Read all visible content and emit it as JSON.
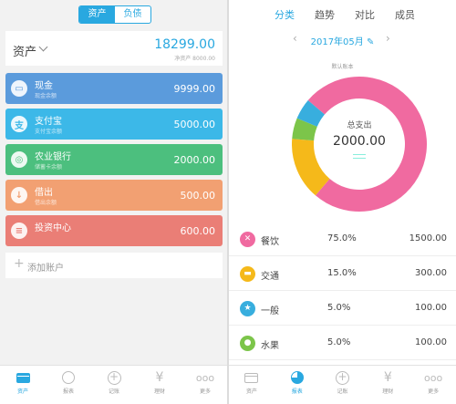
{
  "left": {
    "segment": [
      "资产",
      "负债"
    ],
    "summary_title": "资产",
    "summary_amount": "18299.00",
    "summary_sub": "净资产 8000.00",
    "accounts": [
      {
        "icon": "cash-icon",
        "glyph": "▭",
        "name": "现金",
        "desc": "现金余额",
        "value": "9999.00",
        "color": "#5b9bdc"
      },
      {
        "icon": "alipay-icon",
        "glyph": "支",
        "name": "支付宝",
        "desc": "支付宝余额",
        "value": "5000.00",
        "color": "#3cb8e8"
      },
      {
        "icon": "bank-icon",
        "glyph": "◎",
        "name": "农业银行",
        "desc": "储蓄卡余额",
        "value": "2000.00",
        "color": "#4cbf7e"
      },
      {
        "icon": "loan-icon",
        "glyph": "↓",
        "name": "借出",
        "desc": "借出余额",
        "value": "500.00",
        "color": "#f2a072"
      },
      {
        "icon": "invest-icon",
        "glyph": "≡",
        "name": "投资中心",
        "desc": "",
        "value": "600.00",
        "color": "#ea7e76"
      }
    ],
    "add_label": "添加账户"
  },
  "tabbar": [
    "资产",
    "报表",
    "记账",
    "理财",
    "更多"
  ],
  "right": {
    "tabs": [
      "分类",
      "趋势",
      "对比",
      "成员"
    ],
    "month": "2017年05月",
    "hint": "默认账本",
    "total_label": "总支出",
    "total_value": "2000.00",
    "rows": [
      {
        "icon": "dining-icon",
        "glyph": "✕",
        "name": "餐饮",
        "pct": "75.0%",
        "value": "1500.00",
        "color": "#f06aa0"
      },
      {
        "icon": "transit-icon",
        "glyph": "▬",
        "name": "交通",
        "pct": "15.0%",
        "value": "300.00",
        "color": "#f5b91a"
      },
      {
        "icon": "general-icon",
        "glyph": "★",
        "name": "一般",
        "pct": "5.0%",
        "value": "100.00",
        "color": "#38aede"
      },
      {
        "icon": "fruit-icon",
        "glyph": "●",
        "name": "水果",
        "pct": "5.0%",
        "value": "100.00",
        "color": "#7cc54a"
      }
    ]
  },
  "chart_data": {
    "type": "pie",
    "categories": [
      "餐饮",
      "交通",
      "一般",
      "水果"
    ],
    "values": [
      1500,
      300,
      100,
      100
    ],
    "colors": [
      "#f06aa0",
      "#f5b91a",
      "#38aede",
      "#7cc54a"
    ]
  }
}
